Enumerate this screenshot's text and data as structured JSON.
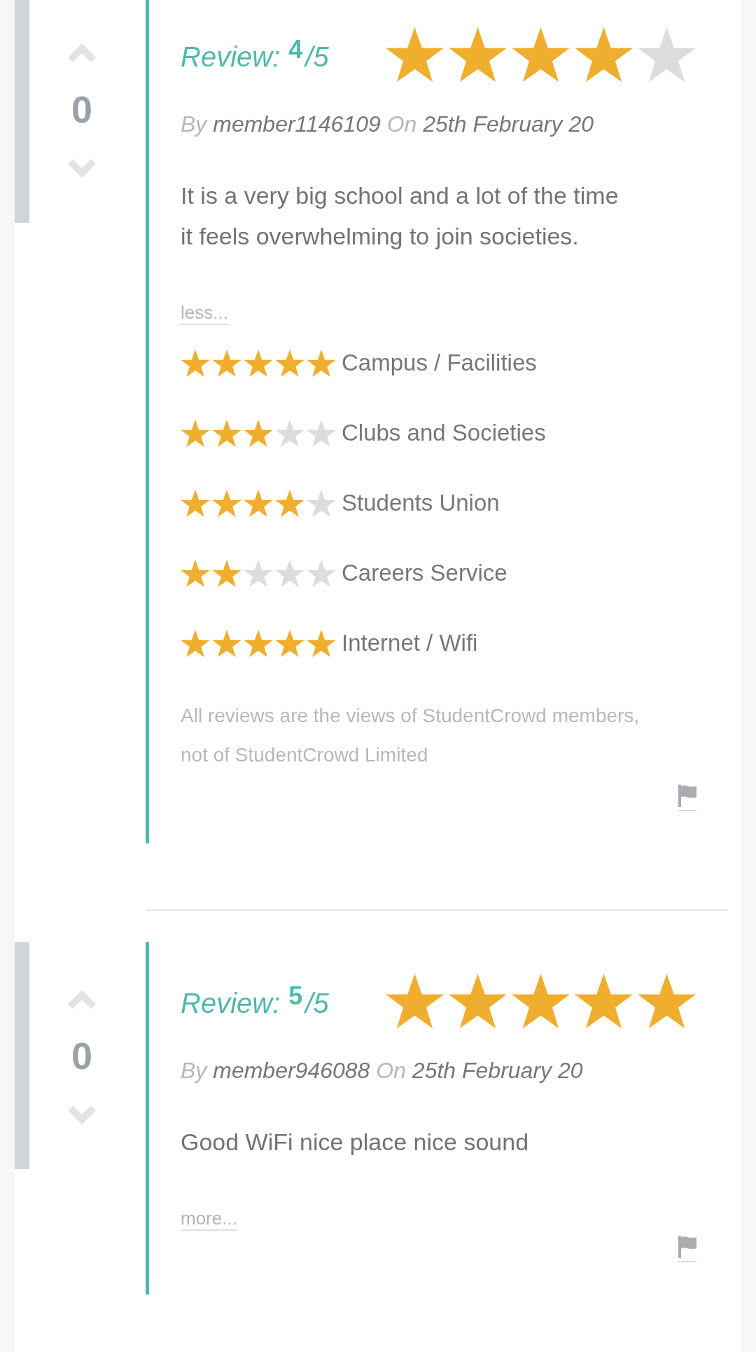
{
  "reviews": [
    {
      "votes": "0",
      "heading": {
        "label": "Review:",
        "score": "4",
        "out_of": "/5"
      },
      "stars": 4,
      "byline": {
        "by": "By",
        "author": "member1146109",
        "on": "On",
        "date": "25th February 20"
      },
      "text": "It is a very big school and a lot of the time it feels overwhelming to join societies.",
      "toggle_link": "less...",
      "category_ratings": [
        {
          "label": "Campus / Facilities",
          "stars": 5
        },
        {
          "label": "Clubs and Societies",
          "stars": 3
        },
        {
          "label": "Students Union",
          "stars": 4
        },
        {
          "label": "Careers Service",
          "stars": 2
        },
        {
          "label": "Internet / Wifi",
          "stars": 5
        }
      ],
      "disclaimer": "All reviews are the views of StudentCrowd members, not of StudentCrowd Limited"
    },
    {
      "votes": "0",
      "heading": {
        "label": "Review:",
        "score": "5",
        "out_of": "/5"
      },
      "stars": 5,
      "byline": {
        "by": "By",
        "author": "member946088",
        "on": "On",
        "date": "25th February 20"
      },
      "text": "Good WiFi nice place nice sound",
      "toggle_link": "more..."
    }
  ]
}
